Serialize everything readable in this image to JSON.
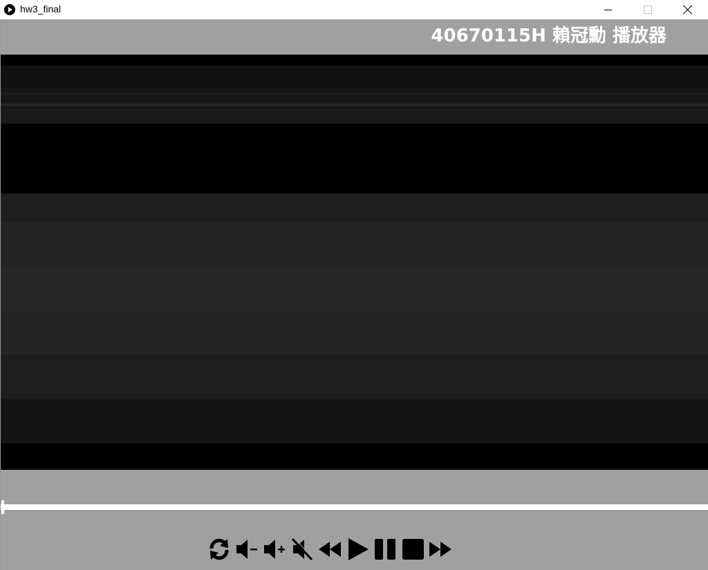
{
  "window": {
    "title": "hw3_final",
    "app_icon": "play-icon",
    "buttons": [
      "minimize-icon",
      "maximize-icon",
      "close-icon"
    ]
  },
  "player": {
    "title": "40670115H 賴冠勳 播放器",
    "background": "#a0a0a0",
    "title_color": "#ffffff",
    "progress": 0.0,
    "progress_color": "#ffffff"
  },
  "controls": [
    {
      "name": "loop",
      "icon": "loop-icon"
    },
    {
      "name": "volume-down",
      "icon": "volume-down-icon"
    },
    {
      "name": "volume-up",
      "icon": "volume-up-icon"
    },
    {
      "name": "mute",
      "icon": "mute-icon"
    },
    {
      "name": "rewind",
      "icon": "rewind-icon"
    },
    {
      "name": "play",
      "icon": "play-icon"
    },
    {
      "name": "pause",
      "icon": "pause-icon"
    },
    {
      "name": "stop",
      "icon": "stop-icon"
    },
    {
      "name": "fast-forward",
      "icon": "fast-forward-icon"
    }
  ]
}
